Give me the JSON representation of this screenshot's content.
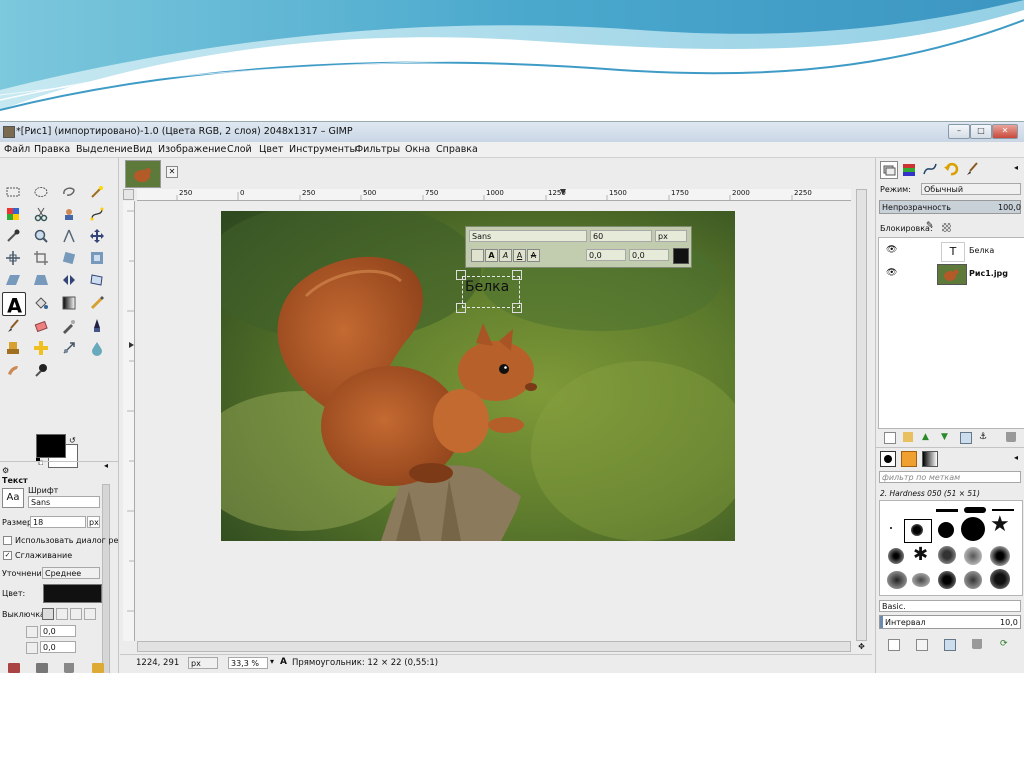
{
  "window": {
    "title": "*[Рис1] (импортировано)-1.0 (Цвета RGB, 2 слоя) 2048x1317 – GIMP",
    "controls": [
      "–",
      "□",
      "✕"
    ]
  },
  "menu": {
    "items": [
      "Файл",
      "Правка",
      "Выделение",
      "Вид",
      "Изображение",
      "Слой",
      "Цвет",
      "Инструменты",
      "Фильтры",
      "Окна",
      "Справка"
    ]
  },
  "ruler": {
    "h_ticks": [
      "250",
      "0",
      "250",
      "500",
      "750",
      "1000",
      "1250",
      "1500",
      "1750",
      "2000",
      "2250"
    ]
  },
  "text_tool_box": {
    "font": "Sans",
    "size": "60",
    "unit": "px",
    "baseline": "0,0",
    "kerning": "0,0"
  },
  "canvas_text": "Белка",
  "status": {
    "coords": "1224, 291",
    "unit": "px",
    "zoom": "33,3 %",
    "message": "Прямоугольник: 12 × 22  (0,55:1)"
  },
  "tool_options": {
    "title": "Текст",
    "font_label": "Шрифт",
    "font_value": "Sans",
    "size_label": "Размер:",
    "size_value": "18",
    "size_unit": "px",
    "use_editor_label": "Использовать диалог ре",
    "antialias_label": "Сглаживание",
    "hinting_label": "Уточнение:",
    "hinting_value": "Среднее",
    "color_label": "Цвет:",
    "justify_label": "Выключка:",
    "indent_value": "0,0",
    "line_spacing_value": "0,0",
    "font_preview": "Aa"
  },
  "layers": {
    "mode_label": "Режим:",
    "mode_value": "Обычный",
    "opacity_label": "Непрозрачность",
    "opacity_value": "100,0",
    "lock_label": "Блокировка:",
    "items": [
      {
        "name": "Белка",
        "thumb": "T"
      },
      {
        "name": "Рис1.jpg",
        "thumb": "img"
      }
    ]
  },
  "brushes": {
    "filter_placeholder": "фильтр по меткам",
    "selected": "2. Hardness 050 (51 × 51)",
    "preset": "Basic.",
    "spacing_label": "Интервал",
    "spacing_value": "10,0"
  },
  "colors": {
    "fg": "#000000",
    "bg": "#ffffff",
    "text_color": "#111111",
    "accent": "#6ea9c9"
  }
}
